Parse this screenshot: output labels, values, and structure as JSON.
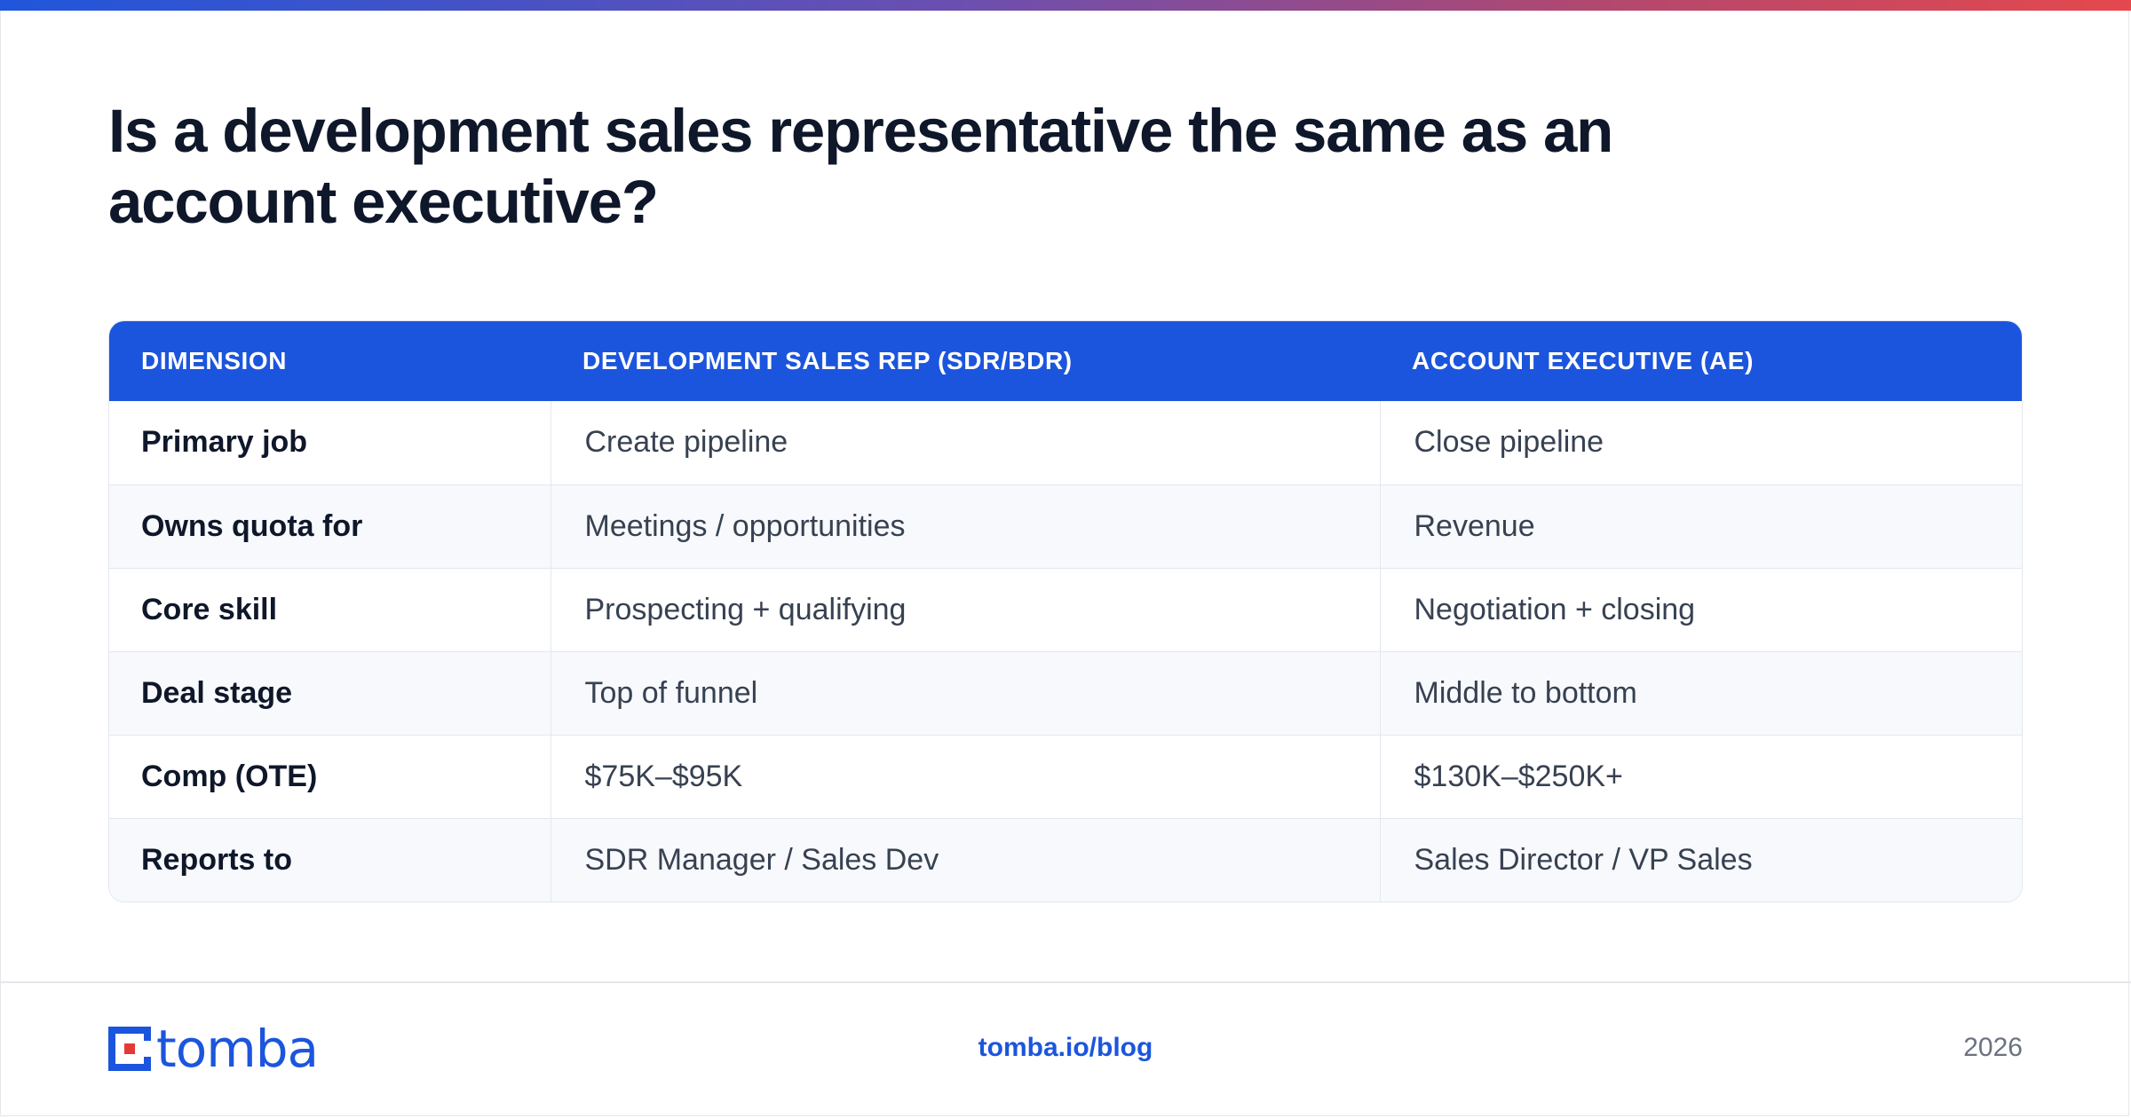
{
  "title": "Is a development sales representative the same as an account executive?",
  "table": {
    "headers": [
      "DIMENSION",
      "DEVELOPMENT SALES REP (SDR/BDR)",
      "ACCOUNT EXECUTIVE (AE)"
    ],
    "rows": [
      [
        "Primary job",
        "Create pipeline",
        "Close pipeline"
      ],
      [
        "Owns quota for",
        "Meetings / opportunities",
        "Revenue"
      ],
      [
        "Core skill",
        "Prospecting + qualifying",
        "Negotiation + closing"
      ],
      [
        "Deal stage",
        "Top of funnel",
        "Middle to bottom"
      ],
      [
        "Comp (OTE)",
        "$75K–$95K",
        "$130K–$250K+"
      ],
      [
        "Reports to",
        "SDR Manager / Sales Dev",
        "Sales Director / VP Sales"
      ]
    ]
  },
  "footer": {
    "logo_text": "tomba",
    "link": "tomba.io/blog",
    "year": "2026"
  },
  "colors": {
    "brand_blue": "#1c55dd",
    "logo_red": "#e53935",
    "accent_gradient_start": "#2056db",
    "accent_gradient_end": "#e5484d"
  }
}
